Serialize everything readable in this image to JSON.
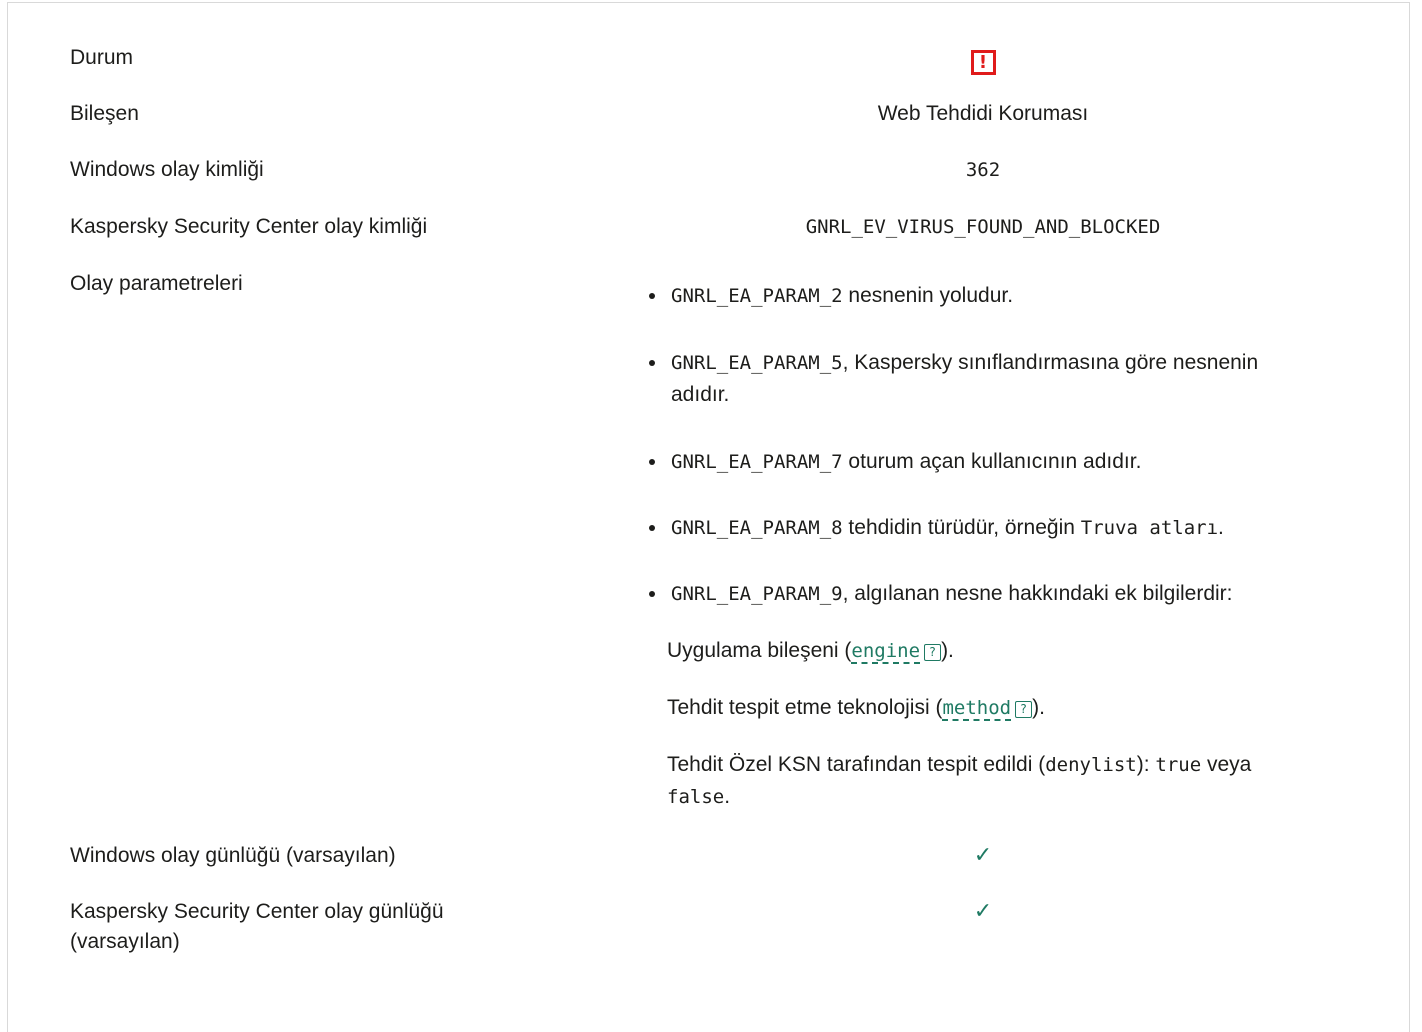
{
  "rows": {
    "status": {
      "label": "Durum",
      "value": "!"
    },
    "component": {
      "label": "Bileşen",
      "value": "Web Tehdidi Koruması"
    },
    "windows_event_id": {
      "label": "Windows olay kimliği",
      "value": "362"
    },
    "ksc_event_id": {
      "label": "Kaspersky Security Center olay kimliği",
      "value": "GNRL_EV_VIRUS_FOUND_AND_BLOCKED"
    },
    "event_params": {
      "label": "Olay parametreleri"
    },
    "windows_log": {
      "label": "Windows olay günlüğü (varsayılan)",
      "value": "✓"
    },
    "ksc_log": {
      "label_line1": "Kaspersky Security Center olay günlüğü",
      "label_line2": "(varsayılan)",
      "value": "✓"
    }
  },
  "params": {
    "p2": {
      "code": "GNRL_EA_PARAM_2",
      "text": " nesnenin yoludur."
    },
    "p5": {
      "code": "GNRL_EA_PARAM_5",
      "text_line1": ", Kaspersky sınıflandırmasına göre nesnenin",
      "text_line2": "adıdır."
    },
    "p7": {
      "code": "GNRL_EA_PARAM_7",
      "text": " oturum açan kullanıcının adıdır."
    },
    "p8": {
      "code": "GNRL_EA_PARAM_8",
      "text": " tehdidin türüdür, örneğin ",
      "example": "Truva atları",
      "end": "."
    },
    "p9": {
      "code": "GNRL_EA_PARAM_9",
      "text": ", algılanan nesne hakkındaki ek bilgilerdir:"
    }
  },
  "details": {
    "engine": {
      "before": "Uygulama bileşeni (",
      "link": "engine",
      "help": "?",
      "after": ")."
    },
    "method": {
      "before": "Tehdit tespit etme teknolojisi (",
      "link": "method",
      "help": "?",
      "after": ")."
    },
    "denylist": {
      "before": "Tehdit Özel KSN tarafından tespit edildi (",
      "code": "denylist",
      "mid": "): ",
      "true_val": "true",
      "or_word": " veya",
      "false_val": "false",
      "end": "."
    }
  },
  "colors": {
    "accent": "#1f7a63",
    "error": "#e01b1b",
    "text": "#1d1d1b",
    "border": "#d9d9d9"
  }
}
